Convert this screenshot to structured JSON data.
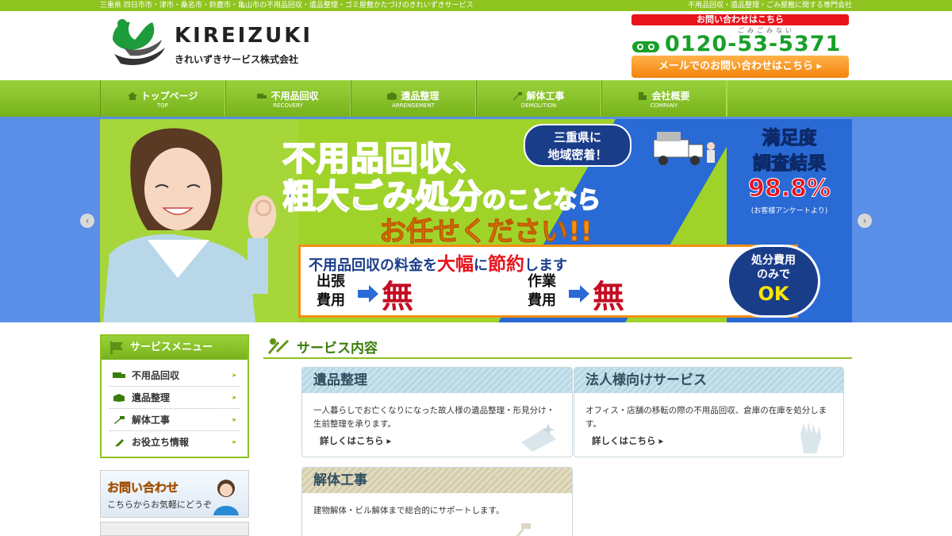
{
  "topbar": {
    "left": "三重県 四日市市・津市・桑名市・鈴鹿市・亀山市の不用品回収・遺品整理・ゴミ屋敷かたづけのきれいずきサービス",
    "right": "不用品回収・遺品整理・ごみ屋敷に関する専門会社"
  },
  "header": {
    "logo_title": "KIREIZUKI",
    "logo_sub": "きれいずきサービス株式会社",
    "contact_tag": "お問い合わせはこちら",
    "tel_ruby": "ごみごみない",
    "tel_number": "0120-53-5371",
    "mail_button": "メールでのお問い合わせはこちら ▸"
  },
  "nav": {
    "items": [
      {
        "label": "トップページ",
        "sub": "TOP",
        "icon": "home-icon"
      },
      {
        "label": "不用品回収",
        "sub": "RECOVERY",
        "icon": "truck-icon"
      },
      {
        "label": "遺品整理",
        "sub": "ARRENGEMENT",
        "icon": "box-icon"
      },
      {
        "label": "解体工事",
        "sub": "DEMOLITION",
        "icon": "hammer-icon"
      },
      {
        "label": "会社概要",
        "sub": "COMPANY",
        "icon": "building-icon"
      }
    ]
  },
  "hero": {
    "line1": "不用品回収、",
    "line2": "粗大ごみ処分",
    "line2_tail": "のことなら",
    "line3": "お任せください!!",
    "bubble": "三重県に\n地域密着！",
    "sat_title_1": "満足度",
    "sat_title_2": "調査結果",
    "sat_value": "98.8%",
    "sat_note": "(お客様アンケートより)",
    "save_pre": "不用品回収の料金を",
    "save_big1": "大幅",
    "save_mid": "に",
    "save_big2": "節約",
    "save_post": "します",
    "pair1_label": "出張\n費用",
    "pair2_label": "作業\n費用",
    "free": "無料",
    "badge_line1": "処分費用",
    "badge_line2": "のみで",
    "badge_ok": "OK",
    "prev": "‹",
    "next": "›"
  },
  "sidebar": {
    "title": "サービスメニュー",
    "items": [
      {
        "label": "不用品回収"
      },
      {
        "label": "遺品整理"
      },
      {
        "label": "解体工事"
      },
      {
        "label": "お役立ち情報"
      }
    ],
    "chevron": "▸",
    "banner_title": "お問い合わせ",
    "banner_sub": "こちらからお気軽にどうぞ"
  },
  "main": {
    "section_title": "サービス内容",
    "cards": [
      {
        "title": "遺品整理",
        "body": "一人暮らしでお亡くなりになった故人様の遺品整理・形見分け・生前整理を承ります。",
        "more": "詳しくはこちら ▸"
      },
      {
        "title": "法人様向けサービス",
        "body": "オフィス・店舗の移転の際の不用品回収、倉庫の在庫を処分します。",
        "more": "詳しくはこちら ▸"
      },
      {
        "title": "解体工事",
        "body": "建物解体・ビル解体まで総合的にサポートします。"
      }
    ]
  },
  "colors": {
    "brand_green": "#8fc31f",
    "tel_green": "#17a02a",
    "alert_red": "#e8131d",
    "orange": "#f58f10",
    "navy": "#1a3d8a"
  }
}
